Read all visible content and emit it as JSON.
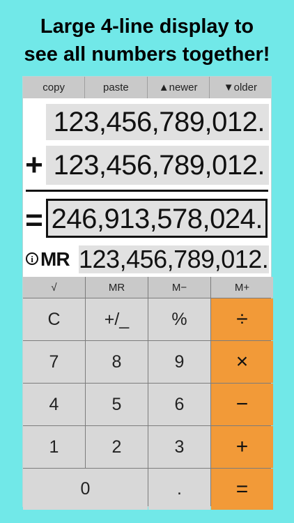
{
  "headline": {
    "line1": "Large 4-line display to",
    "line2": "see all numbers together!"
  },
  "toolbar": {
    "copy": "copy",
    "paste": "paste",
    "newer": "▲newer",
    "older": "▼older"
  },
  "display": {
    "line1": "123,456,789,012.",
    "line2_op": "+",
    "line2": "123,456,789,012.",
    "result_op": "=",
    "result": "246,913,578,024.",
    "info_icon": "i",
    "memory_label": "MR",
    "memory": "123,456,789,012."
  },
  "keys": {
    "sqrt": "√",
    "mr": "MR",
    "m_minus": "M−",
    "m_plus": "M+",
    "clear": "C",
    "plus_minus": "+/_",
    "percent": "%",
    "divide": "÷",
    "seven": "7",
    "eight": "8",
    "nine": "9",
    "multiply": "×",
    "four": "4",
    "five": "5",
    "six": "6",
    "minus": "−",
    "one": "1",
    "two": "2",
    "three": "3",
    "plus": "+",
    "zero": "0",
    "decimal": ".",
    "equals": "="
  },
  "colors": {
    "background": "#71e8e8",
    "operator_key": "#f29a38",
    "digit_key": "#d8d8d8",
    "number_box": "#e1e1e1"
  }
}
